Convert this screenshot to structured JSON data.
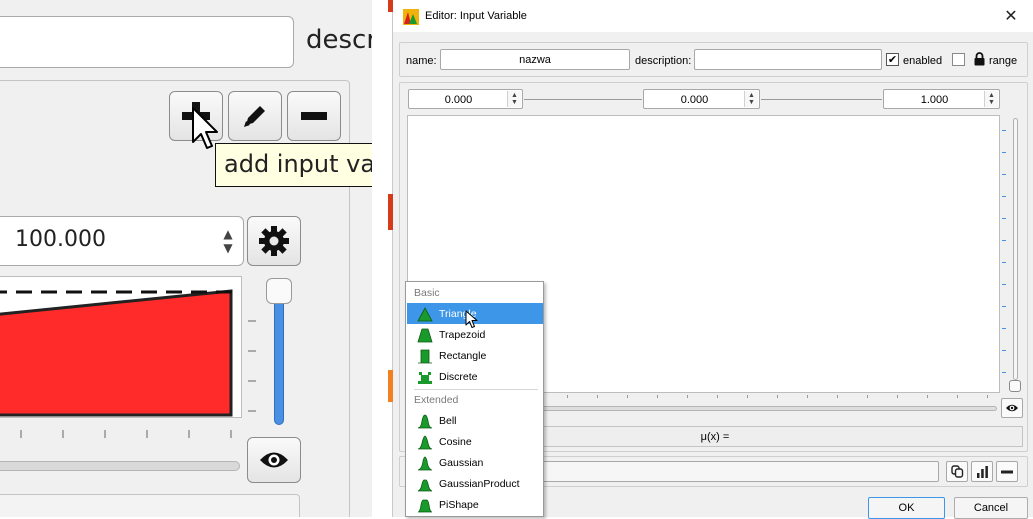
{
  "left_panel": {
    "description_label": "descri",
    "tooltip_text": "add input va",
    "range_max_value": "100.000"
  },
  "dialog": {
    "title": "Editor: Input Variable",
    "name_label": "name:",
    "name_value": "nazwa",
    "description_label": "description:",
    "description_value": "",
    "enabled_label": "enabled",
    "enabled_checked": true,
    "range_label": "range",
    "range_checked": false,
    "spin_min": "0.000",
    "spin_value": "0.000",
    "spin_max": "1.000",
    "mu_label": "μ(x) =",
    "ok_label": "OK",
    "cancel_label": "Cancel"
  },
  "menu": {
    "basic_label": "Basic",
    "extended_label": "Extended",
    "basic_items": [
      "Triangle",
      "Trapezoid",
      "Rectangle",
      "Discrete"
    ],
    "extended_items": [
      "Bell",
      "Cosine",
      "Gaussian",
      "GaussianProduct",
      "PiShape"
    ],
    "highlighted_item": "Triangle"
  },
  "colors": {
    "accent": "#3d96e8",
    "term_fill": "#ff2a2a",
    "icon_green": "#1a9a2a",
    "slider_blue": "#4a90e2"
  }
}
